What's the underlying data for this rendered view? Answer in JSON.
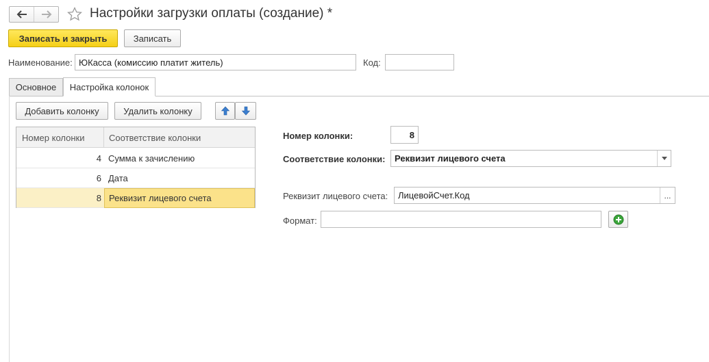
{
  "window": {
    "title": "Настройки загрузки оплаты (создание) *"
  },
  "toolbar": {
    "save_close_label": "Записать и закрыть",
    "save_label": "Записать"
  },
  "header_fields": {
    "name_label": "Наименование:",
    "name_value": "ЮКасса (комиссию платит житель)",
    "code_label": "Код:",
    "code_value": ""
  },
  "tabs": [
    {
      "label": "Основное",
      "active": false
    },
    {
      "label": "Настройка колонок",
      "active": true
    }
  ],
  "columns_toolbar": {
    "add_label": "Добавить колонку",
    "delete_label": "Удалить колонку"
  },
  "table": {
    "headers": [
      "Номер колонки",
      "Соответствие колонки"
    ],
    "rows": [
      {
        "number": "4",
        "mapping": "Сумма к зачислению",
        "selected": false
      },
      {
        "number": "6",
        "mapping": "Дата",
        "selected": false
      },
      {
        "number": "8",
        "mapping": "Реквизит лицевого счета",
        "selected": true
      }
    ]
  },
  "details": {
    "column_number_label": "Номер колонки:",
    "column_number_value": "8",
    "mapping_label": "Соответствие колонки:",
    "mapping_value": "Реквизит лицевого счета",
    "account_attr_label": "Реквизит лицевого счета:",
    "account_attr_value": "ЛицевойСчет.Код",
    "format_label": "Формат:",
    "format_value": ""
  },
  "colors": {
    "primary_button": "#f5cf17",
    "selected_row": "#fbf0c6",
    "arrow_blue": "#3b7fd0",
    "add_green": "#3aa53a"
  }
}
